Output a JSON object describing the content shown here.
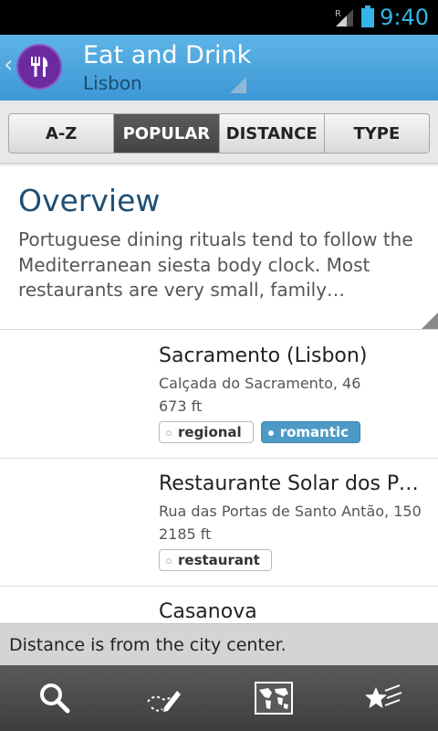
{
  "status_bar": {
    "time": "9:40",
    "signal_label": "R",
    "accent_color": "#33b5e5"
  },
  "header": {
    "back_icon": "chevron-left-icon",
    "app_icon": "fork-knife-icon",
    "title": "Eat and Drink",
    "subtitle": "Lisbon",
    "background_color": "#4aa3dd"
  },
  "tabs": [
    {
      "label": "A-Z",
      "active": false
    },
    {
      "label": "POPULAR",
      "active": true
    },
    {
      "label": "DISTANCE",
      "active": false
    },
    {
      "label": "TYPE",
      "active": false
    }
  ],
  "overview": {
    "title": "Overview",
    "text": "Portuguese dining rituals tend to follow the Mediterranean siesta body clock. Most restaurants are very small, family…"
  },
  "places": [
    {
      "name": "Sacramento (Lisbon)",
      "address": "Calçada do Sacramento, 46",
      "distance": "673 ft",
      "tags": [
        {
          "label": "regional",
          "highlighted": false
        },
        {
          "label": "romantic",
          "highlighted": true
        }
      ]
    },
    {
      "name": "Restaurante Solar dos Pr…",
      "address": "Rua das Portas de Santo Antão, 150",
      "distance": "2185 ft",
      "tags": [
        {
          "label": "restaurant",
          "highlighted": false
        }
      ]
    },
    {
      "name": "Casanova",
      "address": "",
      "distance": "",
      "tags": []
    }
  ],
  "info_bar": {
    "text": "Distance is from the city center."
  },
  "bottom_nav": [
    {
      "icon": "search-icon"
    },
    {
      "icon": "edit-pencil-icon"
    },
    {
      "icon": "world-map-icon"
    },
    {
      "icon": "star-favorites-icon"
    }
  ]
}
